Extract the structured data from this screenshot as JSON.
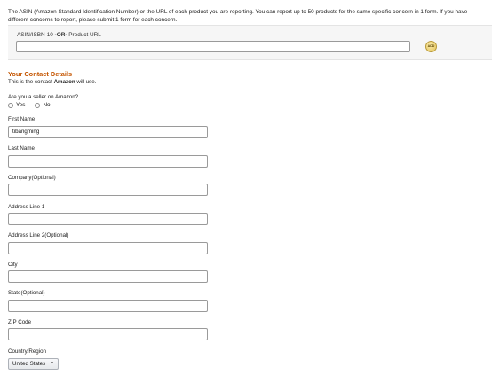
{
  "intro_text": "The ASIN (Amazon Standard Identification Number) or the URL of each product you are reporting. You can report up to 50 products for the same specific concern in 1 form. If you have different concerns to report, please submit 1 form for each concern.",
  "asin": {
    "label_prefix": "ASIN/ISBN-10 ",
    "label_or": "-OR-",
    "label_suffix": " Product URL",
    "value": "",
    "add_button": "ADD"
  },
  "contact": {
    "heading": "Your Contact Details",
    "sub_prefix": "This is the contact ",
    "sub_brand": "Amazon",
    "sub_suffix": " will use.",
    "seller_question": "Are you a seller on Amazon?",
    "seller_options": [
      "Yes",
      "No"
    ]
  },
  "fields": {
    "first_name": {
      "label": "First Name",
      "value": "tibangming"
    },
    "last_name": {
      "label": "Last Name",
      "value": ""
    },
    "company": {
      "label": "Company(Optional)",
      "value": ""
    },
    "address1": {
      "label": "Address Line 1",
      "value": ""
    },
    "address2": {
      "label": "Address Line 2(Optional)",
      "value": ""
    },
    "city": {
      "label": "City",
      "value": ""
    },
    "state": {
      "label": "State(Optional)",
      "value": ""
    },
    "zip": {
      "label": "ZIP Code",
      "value": ""
    },
    "country": {
      "label": "Country/Region",
      "value": "United States"
    }
  }
}
